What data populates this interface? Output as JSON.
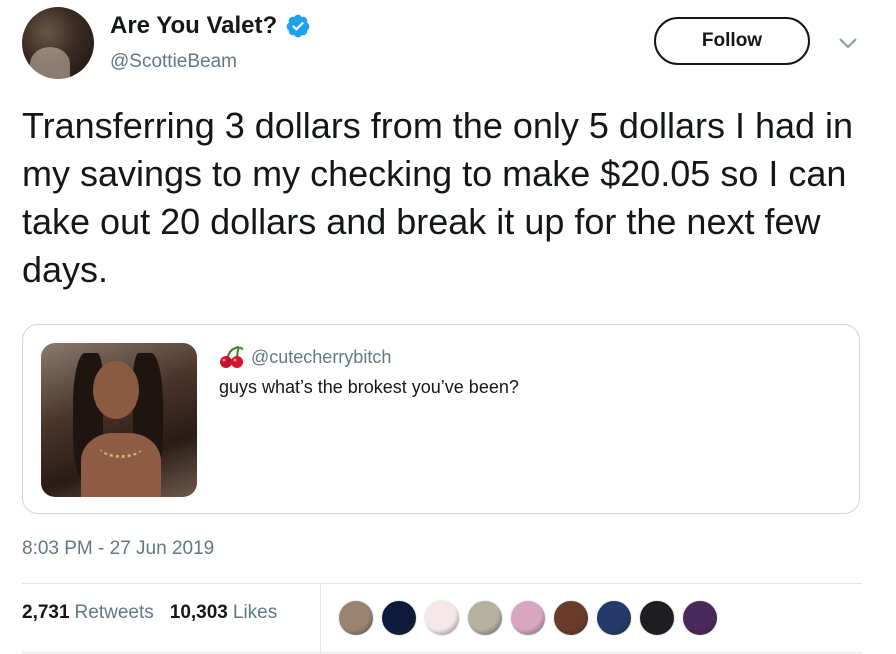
{
  "author": {
    "name": "Are You Valet?",
    "handle": "@ScottieBeam"
  },
  "follow_label": "Follow",
  "tweet": {
    "text": "Transferring 3 dollars from the only 5 dollars I had in my savings to my checking to make $20.05 so I can take out 20 dollars and break it up for the next few days."
  },
  "quote": {
    "handle": "@cutecherrybitch",
    "text": "guys what’s the brokest you’ve been?"
  },
  "timestamp": "8:03 PM - 27 Jun 2019",
  "stats": {
    "retweets_count": "2,731",
    "retweets_label": "Retweets",
    "likes_count": "10,303",
    "likes_label": "Likes"
  },
  "likers_colors": [
    "#9a8470",
    "#0e1a3a",
    "#f6e8e8",
    "#b5b0a0",
    "#d9a6c0",
    "#6a3a2a",
    "#253a6a",
    "#1e1e22",
    "#4a2a5a"
  ],
  "colors": {
    "verified": "#1da1f2",
    "secondary_text": "#657786",
    "border": "#ccd6dd"
  }
}
